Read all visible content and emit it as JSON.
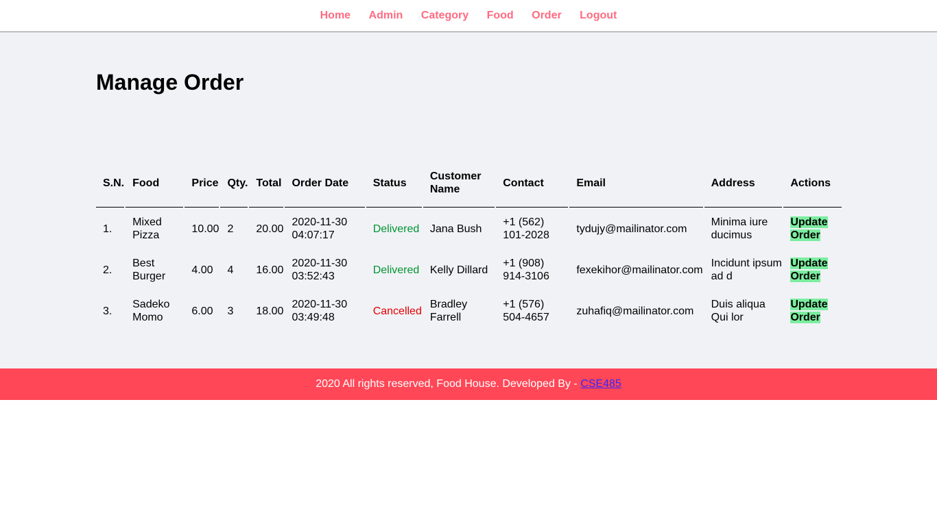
{
  "nav": {
    "items": [
      "Home",
      "Admin",
      "Category",
      "Food",
      "Order",
      "Logout"
    ]
  },
  "page_title": "Manage Order",
  "table": {
    "headers": [
      "S.N.",
      "Food",
      "Price",
      "Qty.",
      "Total",
      "Order Date",
      "Status",
      "Customer Name",
      "Contact",
      "Email",
      "Address",
      "Actions"
    ],
    "rows": [
      {
        "sn": "1.",
        "food": "Mixed Pizza",
        "price": "10.00",
        "qty": "2",
        "total": "20.00",
        "date": "2020-11-30 04:07:17",
        "status": "Delivered",
        "customer": "Jana Bush",
        "contact": "+1 (562) 101-2028",
        "email": "tydujy@mailinator.com",
        "address": "Minima iure ducimus",
        "action": "Update Order"
      },
      {
        "sn": "2.",
        "food": "Best Burger",
        "price": "4.00",
        "qty": "4",
        "total": "16.00",
        "date": "2020-11-30 03:52:43",
        "status": "Delivered",
        "customer": "Kelly Dillard",
        "contact": "+1 (908) 914-3106",
        "email": "fexekihor@mailinator.com",
        "address": "Incidunt ipsum ad d",
        "action": "Update Order"
      },
      {
        "sn": "3.",
        "food": "Sadeko Momo",
        "price": "6.00",
        "qty": "3",
        "total": "18.00",
        "date": "2020-11-30 03:49:48",
        "status": "Cancelled",
        "customer": "Bradley Farrell",
        "contact": "+1 (576) 504-4657",
        "email": "zuhafiq@mailinator.com",
        "address": "Duis aliqua Qui lor",
        "action": "Update Order"
      }
    ]
  },
  "footer": {
    "text": "2020 All rights reserved, Food House. Developed By - ",
    "link": "CSE485"
  },
  "colors": {
    "nav_link": "#ff6b81",
    "main_bg": "#f1f2f6",
    "footer_bg": "#ff4757",
    "delivered": "#009432",
    "cancelled": "#e00000",
    "update_button_bg": "#7bed9f"
  }
}
